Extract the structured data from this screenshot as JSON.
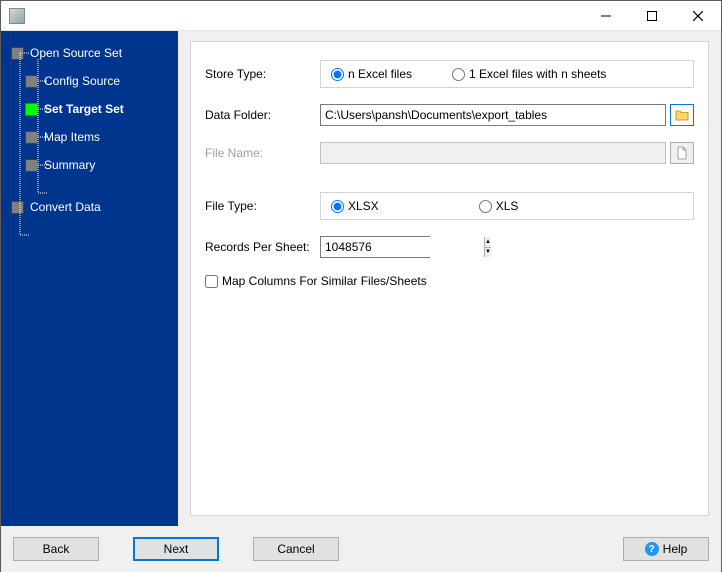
{
  "titlebar": {
    "title": ""
  },
  "sidebar": {
    "items": [
      {
        "label": "Open Source Set"
      },
      {
        "label": "Config Source"
      },
      {
        "label": "Set Target Set"
      },
      {
        "label": "Map Items"
      },
      {
        "label": "Summary"
      },
      {
        "label": "Convert Data"
      }
    ]
  },
  "form": {
    "store_type_label": "Store Type:",
    "store_radio_1": "n Excel files",
    "store_radio_2": "1 Excel files with n sheets",
    "data_folder_label": "Data Folder:",
    "data_folder_value": "C:\\Users\\pansh\\Documents\\export_tables",
    "file_name_label": "File Name:",
    "file_name_value": "",
    "file_type_label": "File Type:",
    "file_type_radio_1": "XLSX",
    "file_type_radio_2": "XLS",
    "records_label": "Records Per Sheet:",
    "records_value": "1048576",
    "map_columns_label": "Map Columns For Similar Files/Sheets"
  },
  "footer": {
    "back": "Back",
    "next": "Next",
    "cancel": "Cancel",
    "help": "Help"
  }
}
